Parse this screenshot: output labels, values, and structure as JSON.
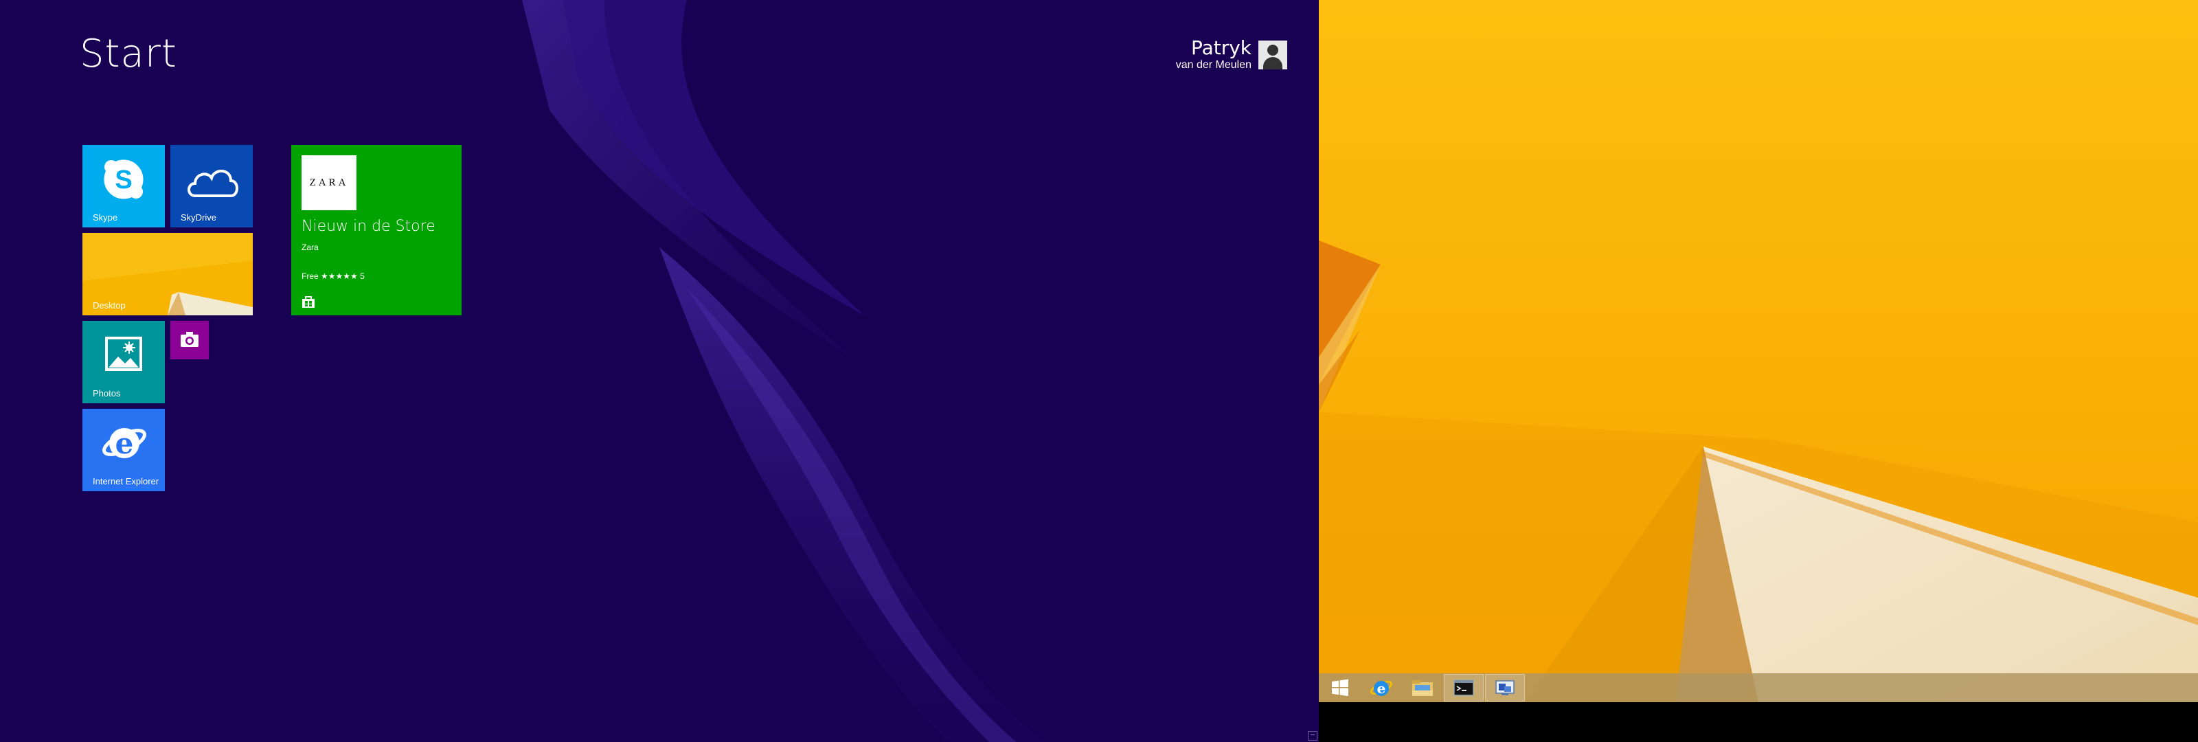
{
  "start": {
    "title": "Start",
    "user": {
      "first_name": "Patryk",
      "last_name": "van der Meulen"
    }
  },
  "tiles": {
    "skype": "Skype",
    "skydrive": "SkyDrive",
    "desktop": "Desktop",
    "photos": "Photos",
    "ie": "Internet Explorer",
    "store": {
      "logo_text": "ZARA",
      "headline": "Nieuw in de Store",
      "app_name": "Zara",
      "price_rating": "Free ★★★★★ 5"
    }
  },
  "colors": {
    "start_bg": "#180052",
    "skype": "#00aced",
    "skydrive": "#094ab2",
    "desktop": "#f7b500",
    "photos": "#00959a",
    "camera": "#8c0095",
    "ie": "#2773f2",
    "store": "#00a300"
  },
  "taskbar": {
    "items": [
      "start-icon",
      "internet-explorer-icon",
      "file-explorer-icon",
      "command-prompt-icon",
      "remote-desktop-icon"
    ]
  }
}
